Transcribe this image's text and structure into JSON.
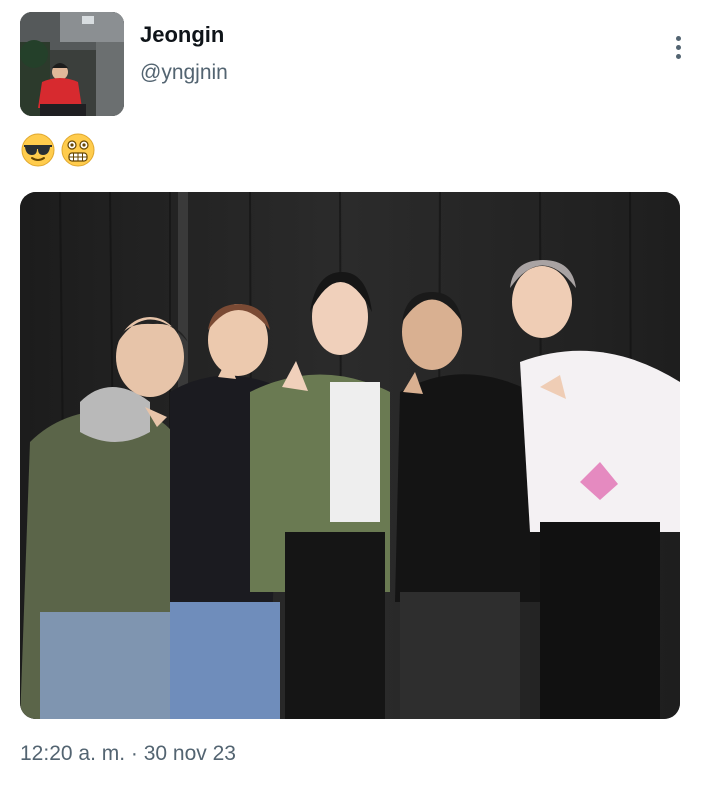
{
  "author": {
    "display_name": "Jeongin",
    "handle": "@yngjnin"
  },
  "tweet": {
    "text_emojis": [
      "sunglasses-face",
      "grimacing-face"
    ]
  },
  "media": {
    "type": "photo",
    "subject_count": 5
  },
  "meta": {
    "timestamp": "12:20 a. m. · 30 nov 23"
  },
  "colors": {
    "text_primary": "#0f1419",
    "text_secondary": "#536471",
    "background": "#ffffff"
  }
}
